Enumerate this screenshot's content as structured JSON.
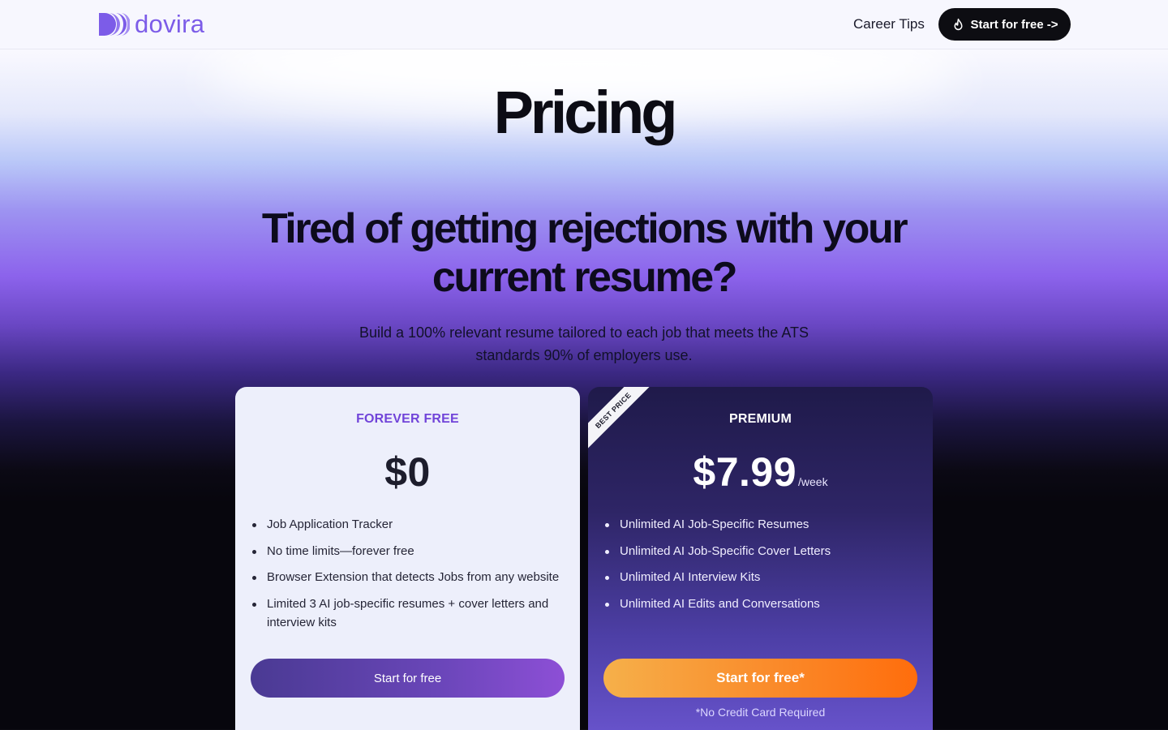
{
  "nav": {
    "brand": "dovira",
    "links": [
      "Career Tips"
    ],
    "cta_label": "Start for free ->"
  },
  "hero": {
    "title": "Pricing",
    "headline": "Tired of getting rejections with your current resume?",
    "subtitle": "Build a 100% relevant resume tailored to each job that meets the ATS standards 90% of employers use."
  },
  "plans": [
    {
      "name": "FOREVER FREE",
      "price": "$0",
      "features": [
        "Job Application Tracker",
        "No time limits—forever free",
        "Browser Extension that detects Jobs from any website",
        "Limited 3 AI job-specific resumes + cover letters and interview kits"
      ],
      "cta_label": "Start for free"
    },
    {
      "name": "PREMIUM",
      "badge": "BEST PRICE",
      "price": "$7.99",
      "period": "/week",
      "features": [
        "Unlimited AI Job-Specific Resumes",
        "Unlimited AI Job-Specific Cover Letters",
        "Unlimited AI Interview Kits",
        "Unlimited AI Edits and Conversations"
      ],
      "cta_label": "Start for free*",
      "note": "*No Credit Card Required"
    }
  ],
  "colors": {
    "brand": "#7c5ce8",
    "free_plan_accent": "#7144d9",
    "premium_button_start": "#f6b04a",
    "premium_button_end": "#ff6d0c",
    "nav_cta_bg": "#0d0d12"
  },
  "icons": {
    "logo": "dovira-logo-mark",
    "nav_cta": "flame-icon"
  }
}
